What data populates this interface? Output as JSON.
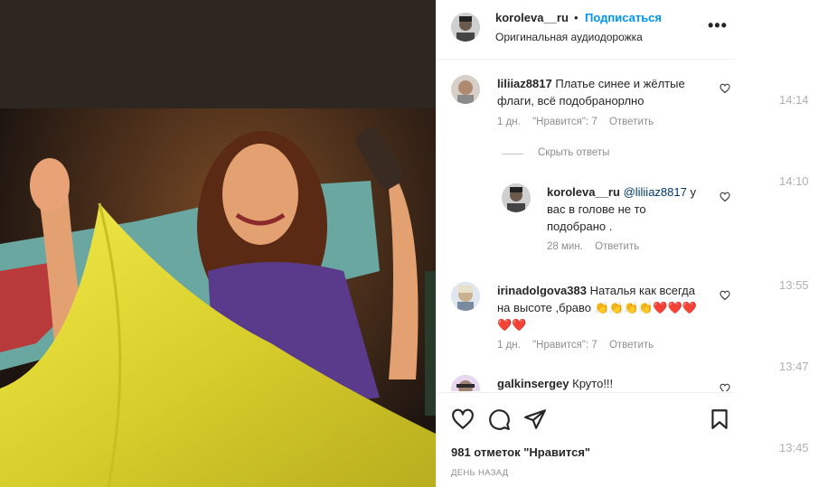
{
  "post": {
    "author": "koroleva__ru",
    "separator": "•",
    "follow_label": "Подписаться",
    "audio_label": "Оригинальная аудиодорожка",
    "more_label": "•••"
  },
  "comments": [
    {
      "user": "liliiaz8817",
      "text": "Платье синее и жёлтые флаги, всё подобранорлно",
      "age": "1 дн.",
      "likes": "\"Нравится\": 7",
      "reply": "Ответить"
    }
  ],
  "hide_replies_label": "Скрыть ответы",
  "reply_comment": {
    "user": "koroleva__ru",
    "mention": "@liliiaz8817",
    "text": "у вас в голове не то подобрано .",
    "age": "28 мин.",
    "reply": "Ответить"
  },
  "comment2": {
    "user": "irinadolgova383",
    "text": "Наталья как всегда на высоте ,браво 👏👏👏👏❤️❤️❤️❤️❤️",
    "age": "1 дн.",
    "likes": "\"Нравится\": 7",
    "reply": "Ответить"
  },
  "comment3": {
    "user": "galkinsergey",
    "text": "Круто!!!"
  },
  "footer": {
    "likes_text": "981 отметок \"Нравится\"",
    "posted_text": "ДЕНЬ НАЗАД"
  },
  "timestamps": [
    "14:14",
    "14:10",
    "13:55",
    "13:47",
    "13:45"
  ],
  "icons": [
    "heart-icon",
    "comment-icon",
    "share-icon",
    "bookmark-icon",
    "more-icon"
  ],
  "colors": {
    "link": "#0095f6",
    "muted": "#8e8e8e",
    "flag_yellow": "#e8e03a"
  }
}
